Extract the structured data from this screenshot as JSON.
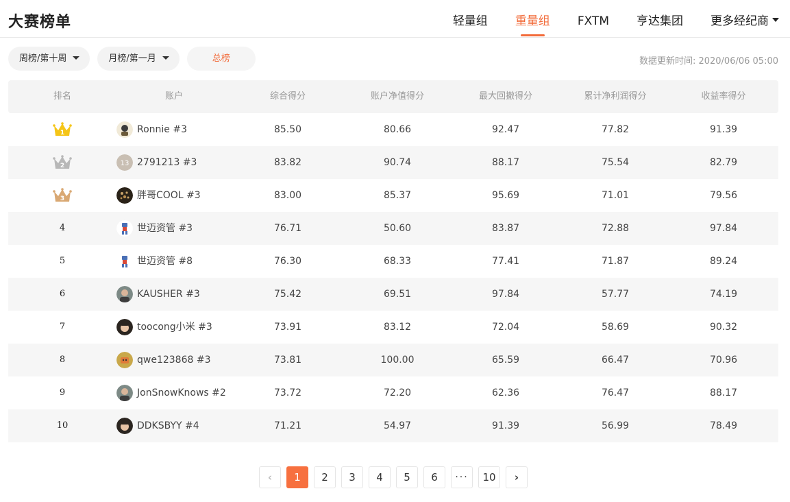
{
  "header": {
    "title": "大赛榜单",
    "tabs": [
      {
        "label": "轻量组"
      },
      {
        "label": "重量组"
      },
      {
        "label": "FXTM"
      },
      {
        "label": "亨达集团"
      },
      {
        "label": "更多经纪商"
      }
    ],
    "active_tab": "重量组"
  },
  "filters": {
    "week": "周榜/第十周",
    "month": "月榜/第一月",
    "total": "总榜",
    "update_time": "数据更新时间: 2020/06/06 05:00"
  },
  "table": {
    "columns": [
      "排名",
      "账户",
      "综合得分",
      "账户净值得分",
      "最大回撤得分",
      "累计净利润得分",
      "收益率得分"
    ],
    "rows": [
      {
        "rank": "1",
        "account": "Ronnie #3",
        "avatar": "badge-avatar",
        "composite": "85.50",
        "equity": "80.66",
        "drawdown": "92.47",
        "net_profit": "77.82",
        "return_rate": "91.39"
      },
      {
        "rank": "2",
        "account": "2791213 #3",
        "avatar": "number-avatar",
        "avatar_text": "13",
        "composite": "83.82",
        "equity": "90.74",
        "drawdown": "88.17",
        "net_profit": "75.54",
        "return_rate": "82.79"
      },
      {
        "rank": "3",
        "account": "胖哥COOL #3",
        "avatar": "leopard-avatar",
        "composite": "83.00",
        "equity": "85.37",
        "drawdown": "95.69",
        "net_profit": "71.01",
        "return_rate": "79.56"
      },
      {
        "rank": "4",
        "account": "世迈资管 #3",
        "avatar": "robot-avatar",
        "composite": "76.71",
        "equity": "50.60",
        "drawdown": "83.87",
        "net_profit": "72.88",
        "return_rate": "97.84"
      },
      {
        "rank": "5",
        "account": "世迈资管 #8",
        "avatar": "robot-avatar",
        "composite": "76.30",
        "equity": "68.33",
        "drawdown": "77.41",
        "net_profit": "71.87",
        "return_rate": "89.24"
      },
      {
        "rank": "6",
        "account": "KAUSHER #3",
        "avatar": "photo-avatar",
        "composite": "75.42",
        "equity": "69.51",
        "drawdown": "97.84",
        "net_profit": "57.77",
        "return_rate": "74.19"
      },
      {
        "rank": "7",
        "account": "toocong小米 #3",
        "avatar": "face-avatar",
        "composite": "73.91",
        "equity": "83.12",
        "drawdown": "72.04",
        "net_profit": "58.69",
        "return_rate": "90.32"
      },
      {
        "rank": "8",
        "account": "qwe123868 #3",
        "avatar": "cartoon-avatar",
        "composite": "73.81",
        "equity": "100.00",
        "drawdown": "65.59",
        "net_profit": "66.47",
        "return_rate": "70.96"
      },
      {
        "rank": "9",
        "account": "JonSnowKnows #2",
        "avatar": "photo-avatar",
        "composite": "73.72",
        "equity": "72.20",
        "drawdown": "62.36",
        "net_profit": "76.47",
        "return_rate": "88.17"
      },
      {
        "rank": "10",
        "account": "DDKSBYY #4",
        "avatar": "face-avatar",
        "composite": "71.21",
        "equity": "54.97",
        "drawdown": "91.39",
        "net_profit": "56.99",
        "return_rate": "78.49"
      }
    ]
  },
  "pagination": {
    "prev": "‹",
    "pages": [
      "1",
      "2",
      "3",
      "4",
      "5",
      "6"
    ],
    "dots": "···",
    "last": "10",
    "next": "›",
    "current": "1"
  },
  "colors": {
    "accent": "#f26b3a",
    "gold": "#f5c518",
    "silver": "#b8b8b8",
    "bronze": "#d9a873"
  }
}
